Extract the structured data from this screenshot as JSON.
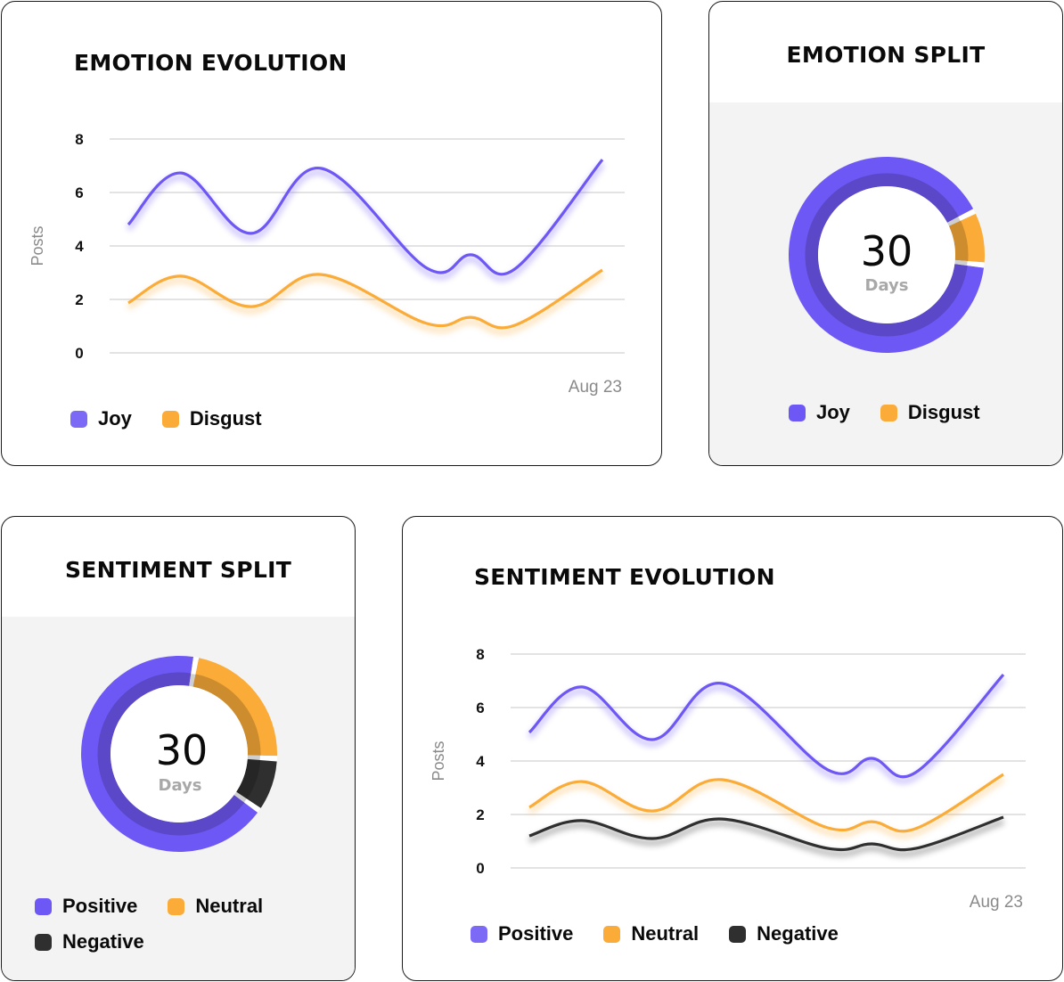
{
  "colors": {
    "purple": "#6e58f5",
    "orange": "#fbab38",
    "dark": "#2f2f2f",
    "grid": "#e4e4e4"
  },
  "emotion_evolution": {
    "title": "EMOTION EVOLUTION",
    "legend": [
      {
        "label": "Joy",
        "color": "#7c6af7"
      },
      {
        "label": "Disgust",
        "color": "#fbab38"
      }
    ]
  },
  "emotion_split": {
    "title": "EMOTION SPLIT",
    "center_value": "30",
    "center_label": "Days",
    "legend": [
      {
        "label": "Joy",
        "color": "#6e58f5"
      },
      {
        "label": "Disgust",
        "color": "#fbab38"
      }
    ]
  },
  "sentiment_split": {
    "title": "SENTIMENT SPLIT",
    "center_value": "30",
    "center_label": "Days",
    "legend": [
      {
        "label": "Positive",
        "color": "#6e58f5"
      },
      {
        "label": "Neutral",
        "color": "#fbab38"
      },
      {
        "label": "Negative",
        "color": "#2f2f2f"
      }
    ]
  },
  "sentiment_evolution": {
    "title": "SENTIMENT EVOLUTION",
    "legend": [
      {
        "label": "Positive",
        "color": "#7c6af7"
      },
      {
        "label": "Neutral",
        "color": "#fbab38"
      },
      {
        "label": "Negative",
        "color": "#2f2f2f"
      }
    ]
  },
  "chart_data": [
    {
      "id": "emotion_evolution",
      "type": "line",
      "title": "EMOTION EVOLUTION",
      "xlabel": "Aug 23",
      "ylabel": "Posts",
      "ylim": [
        0,
        8
      ],
      "yticks": [
        "0",
        "2",
        "4",
        "6",
        "8"
      ],
      "grid": true,
      "legend_position": "bottom-left",
      "x": [
        1,
        4,
        8,
        12,
        18,
        20.5,
        23,
        28
      ],
      "xlim": [
        0,
        29
      ],
      "series": [
        {
          "name": "Joy",
          "color": "#6e58f5",
          "values": [
            4.8,
            6.73,
            4.47,
            6.9,
            3.17,
            3.67,
            3.13,
            7.23
          ]
        },
        {
          "name": "Disgust",
          "color": "#fbab38",
          "values": [
            1.87,
            2.87,
            1.73,
            2.93,
            1.1,
            1.33,
            1.03,
            3.1
          ]
        }
      ]
    },
    {
      "id": "emotion_split",
      "type": "pie",
      "title": "EMOTION SPLIT",
      "center_text": "30 Days",
      "categories": [
        "Joy",
        "Disgust"
      ],
      "values": [
        91,
        9
      ],
      "colors": [
        "#6e58f5",
        "#fbab38"
      ],
      "start_segment": "Disgust",
      "start_angle_deg": 96,
      "legend_position": "bottom"
    },
    {
      "id": "sentiment_split",
      "type": "pie",
      "title": "SENTIMENT SPLIT",
      "center_text": "30 Days",
      "categories": [
        "Neutral",
        "Negative",
        "Positive"
      ],
      "values": [
        23,
        9,
        68
      ],
      "colors": [
        "#fbab38",
        "#2f2f2f",
        "#6e58f5"
      ],
      "start_angle_deg": 10,
      "legend_position": "bottom"
    },
    {
      "id": "sentiment_evolution",
      "type": "line",
      "title": "SENTIMENT EVOLUTION",
      "xlabel": "Aug 23",
      "ylabel": "Posts",
      "ylim": [
        0,
        8
      ],
      "yticks": [
        "0",
        "2",
        "4",
        "6",
        "8"
      ],
      "grid": true,
      "legend_position": "bottom-left",
      "x": [
        1,
        4,
        8,
        12,
        18,
        20.5,
        23,
        28
      ],
      "xlim": [
        0,
        29
      ],
      "series": [
        {
          "name": "Positive",
          "color": "#6e58f5",
          "values": [
            5.07,
            6.77,
            4.8,
            6.9,
            3.67,
            4.1,
            3.57,
            7.23
          ]
        },
        {
          "name": "Neutral",
          "color": "#fbab38",
          "values": [
            2.27,
            3.23,
            2.13,
            3.3,
            1.5,
            1.73,
            1.47,
            3.5
          ]
        },
        {
          "name": "Negative",
          "color": "#2f2f2f",
          "values": [
            1.2,
            1.77,
            1.1,
            1.83,
            0.73,
            0.9,
            0.73,
            1.9
          ]
        }
      ]
    }
  ]
}
